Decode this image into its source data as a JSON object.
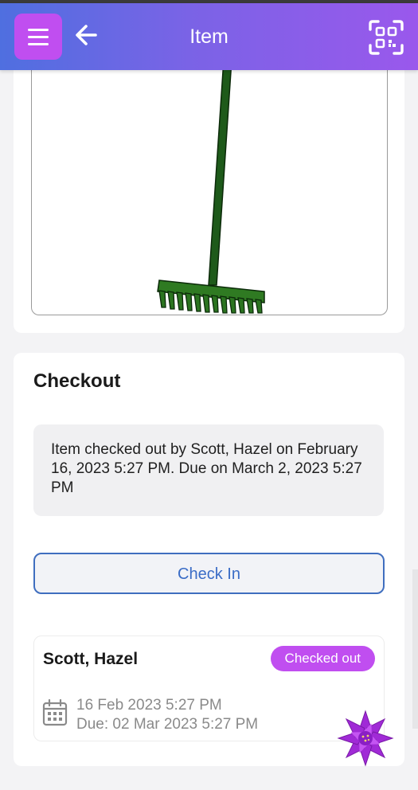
{
  "header": {
    "title": "Item",
    "menu_icon": "hamburger-menu-icon",
    "back_icon": "arrow-left-icon",
    "scan_icon": "qr-scan-icon"
  },
  "item": {
    "image": "rake-image"
  },
  "checkout": {
    "section_title": "Checkout",
    "notice": "Item checked out by Scott, Hazel on February 16, 2023 5:27 PM. Due on March 2, 2023 5:27 PM",
    "checkin_label": "Check In",
    "history": [
      {
        "name": "Scott, Hazel",
        "status": "Checked out",
        "checked_out": "16 Feb 2023 5:27 PM",
        "due": "Due: 02 Mar 2023 5:27 PM"
      }
    ]
  },
  "colors": {
    "accent": "#c04ef0",
    "header_start": "#4f6fe0",
    "header_end": "#9a58ec",
    "button_blue": "#3f6ebf",
    "rake_green": "#1e5a1a"
  }
}
